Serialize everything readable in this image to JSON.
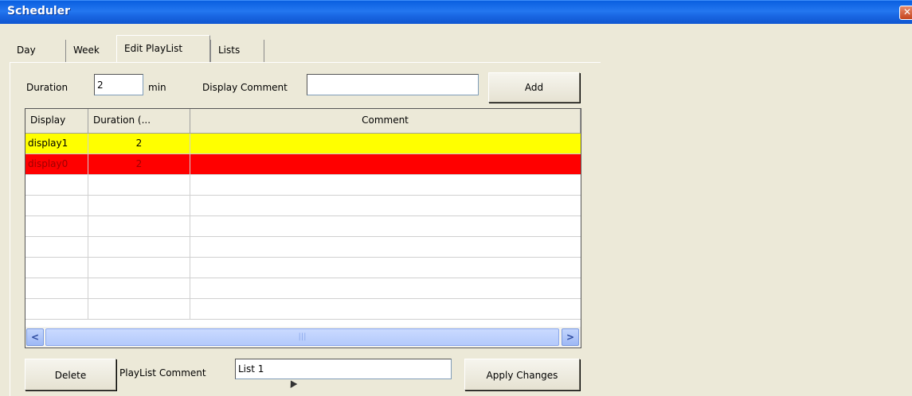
{
  "window": {
    "title": "Scheduler",
    "close_glyph": "✕"
  },
  "tabs": [
    {
      "label": "Day"
    },
    {
      "label": "Week"
    },
    {
      "label": "Edit PlayList"
    },
    {
      "label": "Lists"
    }
  ],
  "active_tab": "Edit PlayList",
  "form": {
    "duration_label": "Duration",
    "duration_value": "2",
    "duration_unit": "min",
    "display_comment_label": "Display Comment",
    "display_comment_value": "",
    "add_label": "Add"
  },
  "grid": {
    "columns": [
      "Display",
      "Duration (...",
      "Comment"
    ],
    "rows": [
      {
        "display": "display1",
        "duration": "2",
        "comment": "",
        "color": "#ffff00",
        "text_color": "#000000"
      },
      {
        "display": "display0",
        "duration": "2",
        "comment": "",
        "color": "#ff0000",
        "text_color": "#a00000"
      }
    ],
    "scroll_left_glyph": "<",
    "scroll_right_glyph": ">",
    "thumb_grip": "|||"
  },
  "footer": {
    "delete_label": "Delete",
    "playlist_comment_label": "PlayList Comment",
    "playlist_comment_value": "List 1",
    "apply_label": "Apply Changes"
  }
}
